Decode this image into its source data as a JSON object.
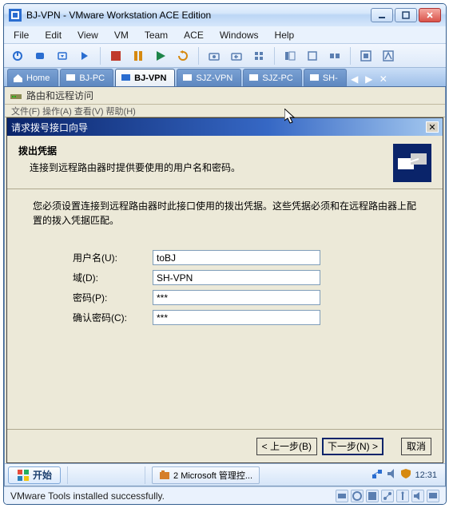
{
  "window": {
    "title": "BJ-VPN - VMware Workstation ACE Edition"
  },
  "menus": [
    "File",
    "Edit",
    "View",
    "VM",
    "Team",
    "ACE",
    "Windows",
    "Help"
  ],
  "tabs": {
    "home": "Home",
    "items": [
      "BJ-PC",
      "BJ-VPN",
      "SJZ-VPN",
      "SJZ-PC",
      "SH-"
    ],
    "active": "BJ-VPN"
  },
  "rras": {
    "title": "路由和远程访问",
    "sub": "文件(F)   操作(A)   查看(V)   帮助(H)"
  },
  "wizard": {
    "title": "请求拨号接口向导",
    "header": "拨出凭据",
    "header_sub": "连接到远程路由器时提供要使用的用户名和密码。",
    "note": "您必须设置连接到远程路由器时此接口使用的拨出凭据。这些凭据必须和在远程路由器上配置的拨入凭据匹配。",
    "labels": {
      "user": "用户名(U):",
      "domain": "域(D):",
      "password": "密码(P):",
      "confirm": "确认密码(C):"
    },
    "values": {
      "user": "toBJ",
      "domain": "SH-VPN",
      "password": "***",
      "confirm": "***"
    },
    "buttons": {
      "back": "< 上一步(B)",
      "next": "下一步(N) >",
      "cancel": "取消"
    }
  },
  "guest_taskbar": {
    "start": "开始",
    "task1": "2 Microsoft 管理控...",
    "clock": "12:31"
  },
  "status": "VMware Tools installed successfully."
}
